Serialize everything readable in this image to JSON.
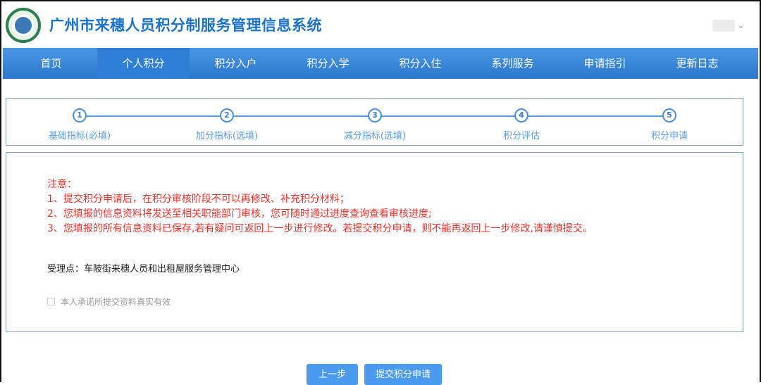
{
  "header": {
    "title": "广州市来穗人员积分制服务管理信息系统"
  },
  "nav": [
    "首页",
    "个人积分",
    "积分入户",
    "积分入学",
    "积分入住",
    "系列服务",
    "申请指引",
    "更新日志"
  ],
  "steps": [
    {
      "num": "1",
      "label": "基础指标(必填)"
    },
    {
      "num": "2",
      "label": "加分指标(选填)"
    },
    {
      "num": "3",
      "label": "减分指标(选填)"
    },
    {
      "num": "4",
      "label": "积分评估"
    },
    {
      "num": "5",
      "label": "积分申请"
    }
  ],
  "notice": {
    "title": "注意：",
    "items": [
      "1、提交积分申请后，在积分审核阶段不可以再修改、补充积分材料；",
      "2、您填报的信息资料将发送至相关职能部门审核，您可随时通过进度查询查看审核进度;",
      "3、您填报的所有信息资料已保存,若有疑问可返回上一步进行修改。若提交积分申请，则不能再返回上一步修改,请谨慎提交。"
    ]
  },
  "acceptance_point": "受理点：车陂街来穗人员和出租屋服务管理中心",
  "agree_label": "本人承诺所提交资料真实有效",
  "buttons": {
    "prev": "上一步",
    "submit": "提交积分申请"
  }
}
